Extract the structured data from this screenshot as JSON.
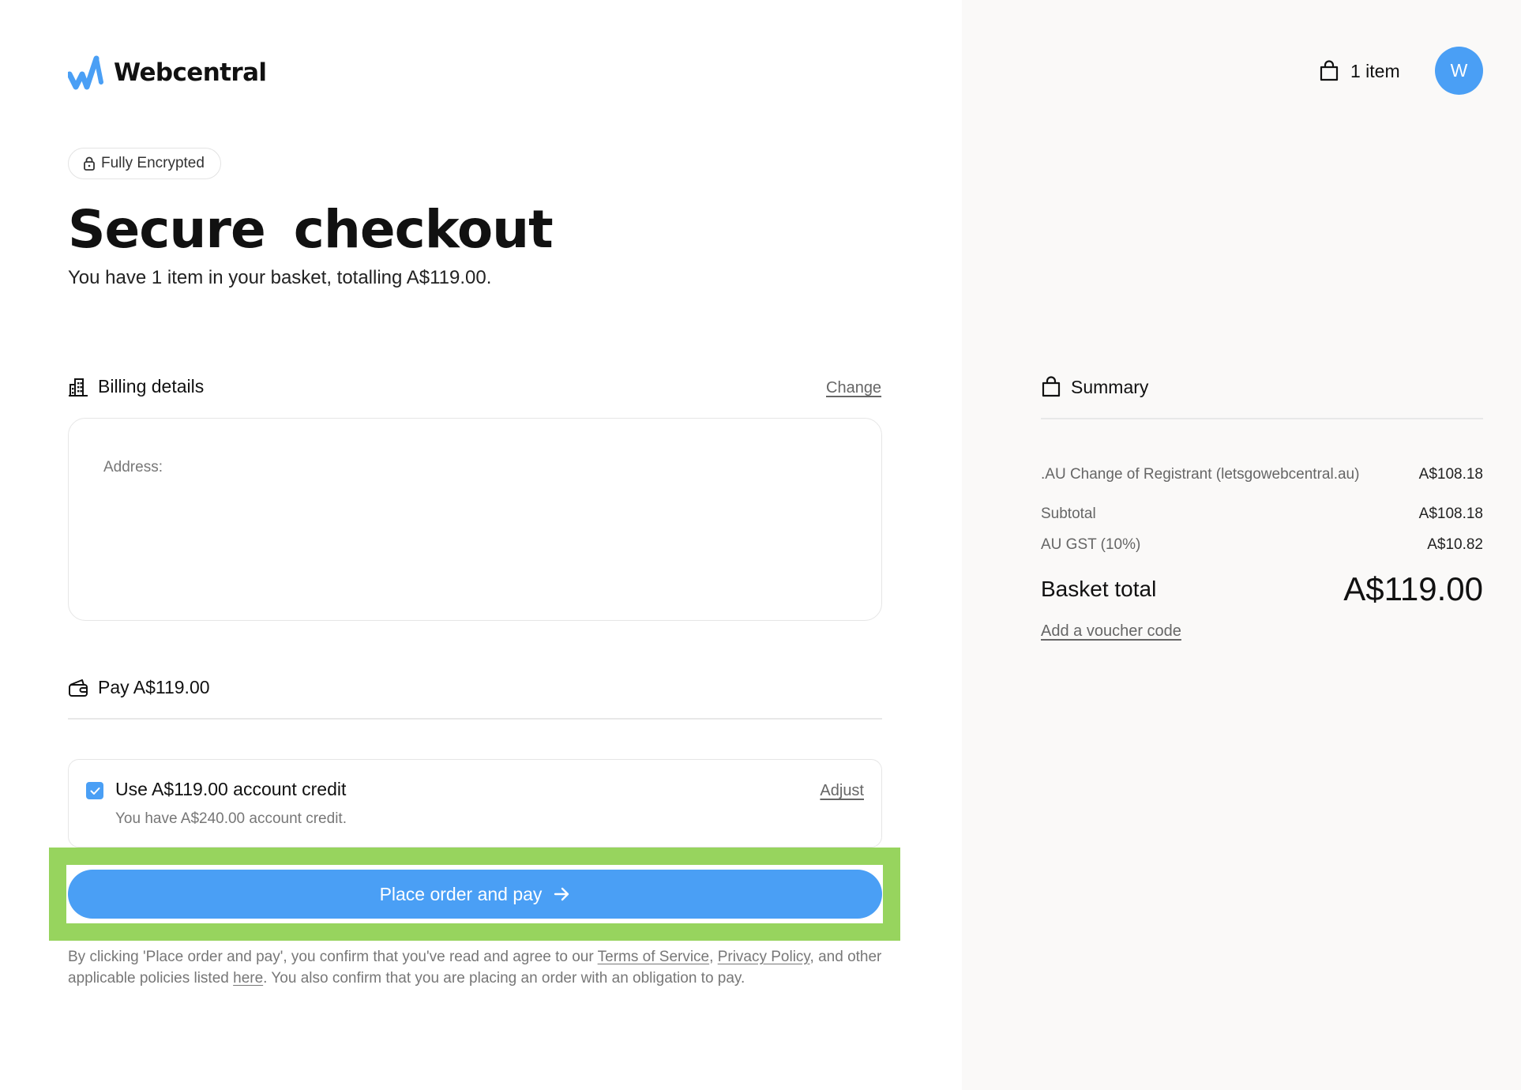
{
  "brand": {
    "name": "Webcentral",
    "accent": "#4a9ff5"
  },
  "security": {
    "badge": "Fully Encrypted"
  },
  "hero": {
    "title_plain": "Secure",
    "title_highlight": "checkout",
    "subtitle": "You have 1 item in your basket, totalling A$119.00."
  },
  "billing": {
    "title": "Billing details",
    "change": "Change",
    "address_label": "Address:"
  },
  "pay": {
    "title": "Pay A$119.00"
  },
  "credit": {
    "checked": true,
    "title": "Use A$119.00 account credit",
    "sub": "You have A$240.00 account credit.",
    "adjust": "Adjust"
  },
  "cta": {
    "label": "Place order and pay"
  },
  "terms": {
    "p1": "By clicking 'Place order and pay', you confirm that you've read and agree to our ",
    "tos": "Terms of Service",
    "sep": ", ",
    "privacy": "Privacy Policy",
    "p2": ", and other applicable policies listed ",
    "here": "here",
    "p3": ". You also confirm that you are placing an order with an obligation to pay."
  },
  "header": {
    "basket_count": "1 item",
    "avatar_initial": "W"
  },
  "summary": {
    "title": "Summary",
    "line_item": {
      "label": ".AU Change of Registrant (letsgowebcentral.au)",
      "amount": "A$108.18"
    },
    "subtotal": {
      "label": "Subtotal",
      "amount": "A$108.18"
    },
    "gst": {
      "label": "AU GST (10%)",
      "amount": "A$10.82"
    },
    "total": {
      "label": "Basket total",
      "amount": "A$119.00"
    },
    "voucher": "Add a voucher code"
  }
}
